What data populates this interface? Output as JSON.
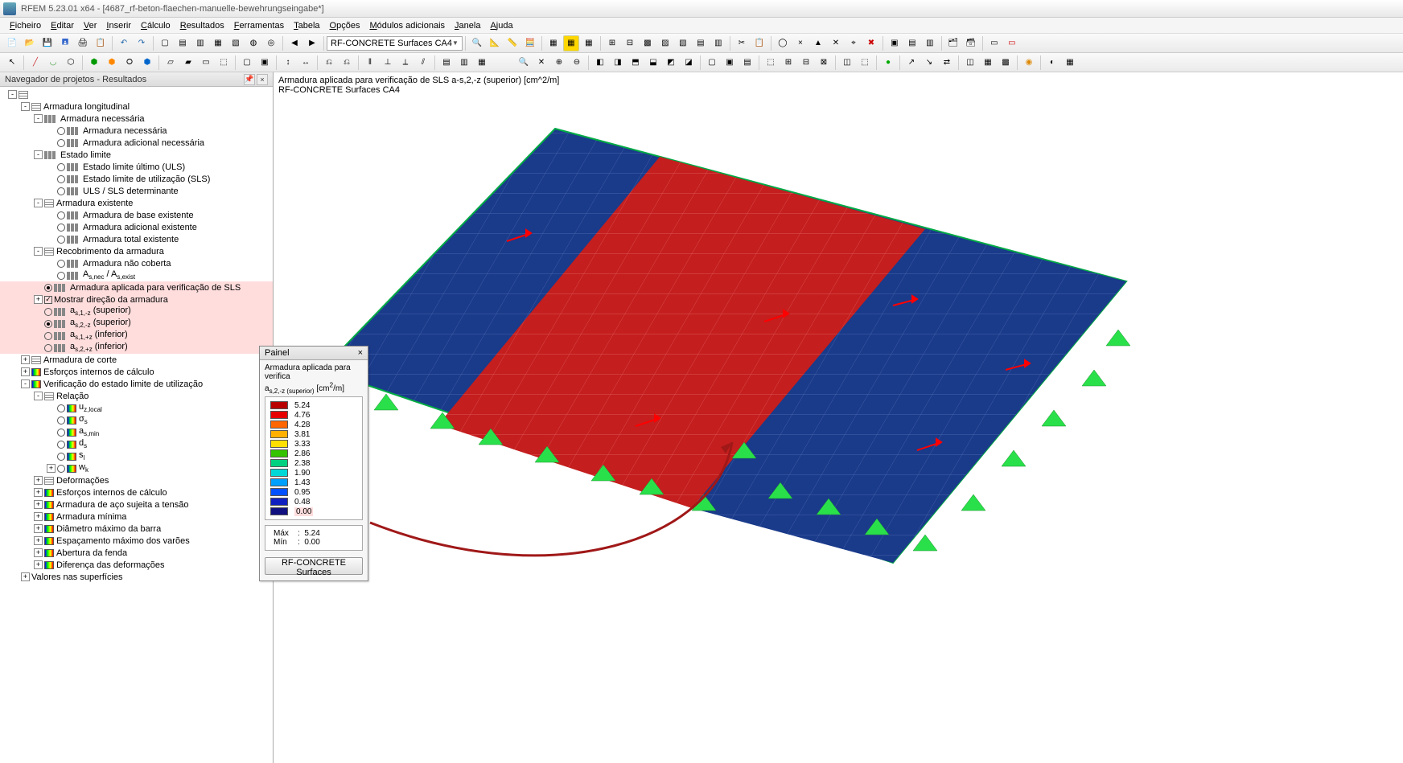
{
  "title": {
    "app": "RFEM 5.23.01 x64",
    "file": "[4687_rf-beton-flaechen-manuelle-bewehrungseingabe*]"
  },
  "menu": [
    "Ficheiro",
    "Editar",
    "Ver",
    "Inserir",
    "Cálculo",
    "Resultados",
    "Ferramentas",
    "Tabela",
    "Opções",
    "Módulos adicionais",
    "Janela",
    "Ajuda"
  ],
  "toolbar_combo": "RF-CONCRETE Surfaces CA4",
  "nav_header": "Navegador de projetos - Resultados",
  "tree": [
    {
      "d": 0,
      "tg": "-",
      "icon": "grid",
      "rb": false,
      "txt": ""
    },
    {
      "d": 1,
      "tg": "-",
      "icon": "grid",
      "rb": false,
      "txt": "Armadura longitudinal"
    },
    {
      "d": 2,
      "tg": "-",
      "icon": "bars",
      "rb": false,
      "txt": "Armadura necessária"
    },
    {
      "d": 3,
      "tg": "",
      "icon": "bars",
      "rb": "o",
      "txt": "Armadura necessária"
    },
    {
      "d": 3,
      "tg": "",
      "icon": "bars",
      "rb": "o",
      "txt": "Armadura adicional necessária"
    },
    {
      "d": 2,
      "tg": "-",
      "icon": "bars",
      "rb": false,
      "txt": "Estado limite"
    },
    {
      "d": 3,
      "tg": "",
      "icon": "bars",
      "rb": "o",
      "txt": "Estado limite último (ULS)"
    },
    {
      "d": 3,
      "tg": "",
      "icon": "bars",
      "rb": "o",
      "txt": "Estado limite de utilização (SLS)"
    },
    {
      "d": 3,
      "tg": "",
      "icon": "bars",
      "rb": "o",
      "txt": "ULS / SLS determinante"
    },
    {
      "d": 2,
      "tg": "-",
      "icon": "grid",
      "rb": false,
      "txt": "Armadura existente"
    },
    {
      "d": 3,
      "tg": "",
      "icon": "bars",
      "rb": "o",
      "txt": "Armadura de base existente"
    },
    {
      "d": 3,
      "tg": "",
      "icon": "bars",
      "rb": "o",
      "txt": "Armadura adicional existente"
    },
    {
      "d": 3,
      "tg": "",
      "icon": "bars",
      "rb": "o",
      "txt": "Armadura total existente"
    },
    {
      "d": 2,
      "tg": "-",
      "icon": "grid",
      "rb": false,
      "txt": "Recobrimento da armadura"
    },
    {
      "d": 3,
      "tg": "",
      "icon": "bars",
      "rb": "o",
      "txt": "Armadura não coberta"
    },
    {
      "d": 3,
      "tg": "",
      "icon": "bars",
      "rb": "o",
      "txt": "A<sub>s,nec</sub> / A<sub>s,exist</sub>"
    },
    {
      "d": 2,
      "tg": "",
      "icon": "bars",
      "rb": "c",
      "txt": "Armadura aplicada para verificação de SLS",
      "hl": true
    },
    {
      "d": 2,
      "tg": "+",
      "icon": "",
      "rb": "chk",
      "txt": "Mostrar direção da armadura",
      "hl": true
    },
    {
      "d": 2,
      "tg": "",
      "icon": "bars",
      "rb": "o",
      "txt": "a<sub>s,1,-z</sub> (superior)",
      "hl": true
    },
    {
      "d": 2,
      "tg": "",
      "icon": "bars",
      "rb": "c",
      "txt": "a<sub>s,2,-z</sub> (superior)",
      "hl": true
    },
    {
      "d": 2,
      "tg": "",
      "icon": "bars",
      "rb": "o",
      "txt": "a<sub>s,1,+z</sub> (inferior)",
      "hl": true
    },
    {
      "d": 2,
      "tg": "",
      "icon": "bars",
      "rb": "o",
      "txt": "a<sub>s,2,+z</sub> (inferior)",
      "hl": true
    },
    {
      "d": 1,
      "tg": "+",
      "icon": "grid",
      "rb": false,
      "txt": "Armadura de corte"
    },
    {
      "d": 1,
      "tg": "+",
      "icon": "grad",
      "rb": false,
      "txt": "Esforços internos de cálculo"
    },
    {
      "d": 1,
      "tg": "-",
      "icon": "grad",
      "rb": false,
      "txt": "Verificação do estado limite de utilização"
    },
    {
      "d": 2,
      "tg": "-",
      "icon": "grid",
      "rb": false,
      "txt": "Relação"
    },
    {
      "d": 3,
      "tg": "",
      "icon": "grad",
      "rb": "o",
      "txt": "u<sub>z,local</sub>"
    },
    {
      "d": 3,
      "tg": "",
      "icon": "grad",
      "rb": "o",
      "txt": "σ<sub>s</sub>"
    },
    {
      "d": 3,
      "tg": "",
      "icon": "grad",
      "rb": "o",
      "txt": "a<sub>s,min</sub>"
    },
    {
      "d": 3,
      "tg": "",
      "icon": "grad",
      "rb": "o",
      "txt": "d<sub>s</sub>"
    },
    {
      "d": 3,
      "tg": "",
      "icon": "grad",
      "rb": "o",
      "txt": "s<sub>l</sub>"
    },
    {
      "d": 3,
      "tg": "+",
      "icon": "grad",
      "rb": "o",
      "txt": "w<sub>k</sub>"
    },
    {
      "d": 2,
      "tg": "+",
      "icon": "grid",
      "rb": false,
      "txt": "Deformações"
    },
    {
      "d": 2,
      "tg": "+",
      "icon": "grad",
      "rb": false,
      "txt": "Esforços internos de cálculo"
    },
    {
      "d": 2,
      "tg": "+",
      "icon": "grad",
      "rb": false,
      "txt": "Armadura de aço sujeita a tensão"
    },
    {
      "d": 2,
      "tg": "+",
      "icon": "grad",
      "rb": false,
      "txt": "Armadura mínima"
    },
    {
      "d": 2,
      "tg": "+",
      "icon": "grad",
      "rb": false,
      "txt": "Diâmetro máximo da barra"
    },
    {
      "d": 2,
      "tg": "+",
      "icon": "grad",
      "rb": false,
      "txt": "Espaçamento máximo dos varões"
    },
    {
      "d": 2,
      "tg": "+",
      "icon": "grad",
      "rb": false,
      "txt": "Abertura da fenda"
    },
    {
      "d": 2,
      "tg": "+",
      "icon": "grad",
      "rb": false,
      "txt": "Diferença das deformações"
    },
    {
      "d": 1,
      "tg": "+",
      "icon": "",
      "rb": false,
      "txt": "Valores nas superfícies"
    }
  ],
  "viewport": {
    "line1": "Armadura aplicada para verificação de SLS a-s,2,-z (superior) [cm^2/m]",
    "line2": "RF-CONCRETE Surfaces CA4"
  },
  "panel": {
    "title": "Painel",
    "desc_line1": "Armadura aplicada para verifica",
    "desc_line2": "a<sub>s,2,-z (superior)</sub> [cm<sup>2</sup>/m]",
    "legend": [
      {
        "c": "#b80000",
        "v": "5.24"
      },
      {
        "c": "#e60000",
        "v": "4.76"
      },
      {
        "c": "#ff6600",
        "v": "4.28"
      },
      {
        "c": "#ffb000",
        "v": "3.81"
      },
      {
        "c": "#ffe000",
        "v": "3.33"
      },
      {
        "c": "#34c300",
        "v": "2.86"
      },
      {
        "c": "#00d080",
        "v": "2.38"
      },
      {
        "c": "#00d8d8",
        "v": "1.90"
      },
      {
        "c": "#00a0ff",
        "v": "1.43"
      },
      {
        "c": "#0050ff",
        "v": "0.95"
      },
      {
        "c": "#1020c0",
        "v": "0.48"
      },
      {
        "c": "#101080",
        "v": "0.00",
        "hl": true
      }
    ],
    "max_label": "Máx",
    "max_val": "5.24",
    "min_label": "Mín",
    "min_val": "0.00",
    "module_btn": "RF-CONCRETE Surfaces"
  }
}
